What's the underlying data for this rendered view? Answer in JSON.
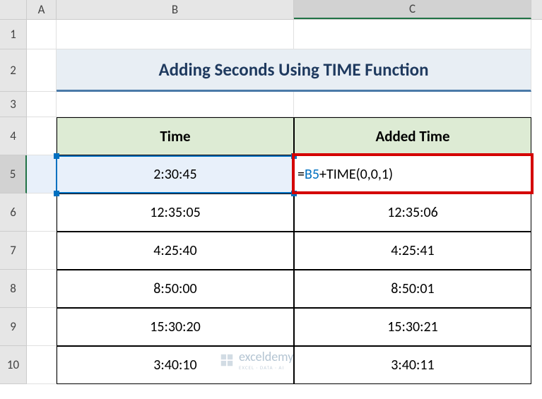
{
  "columns": {
    "A": "A",
    "B": "B",
    "C": "C"
  },
  "rows": {
    "1": "1",
    "2": "2",
    "3": "3",
    "4": "4",
    "5": "5",
    "6": "6",
    "7": "7",
    "8": "8",
    "9": "9",
    "10": "10"
  },
  "title": "Adding Seconds Using TIME Function",
  "headers": {
    "time": "Time",
    "added": "Added Time"
  },
  "data": [
    {
      "time": "2:30:45",
      "added_display": "formula"
    },
    {
      "time": "12:35:05",
      "added": "12:35:06"
    },
    {
      "time": "4:25:40",
      "added": "4:25:41"
    },
    {
      "time": "8:50:00",
      "added": "8:50:01"
    },
    {
      "time": "15:30:20",
      "added": "15:30:21"
    },
    {
      "time": "3:40:10",
      "added": "3:40:11"
    }
  ],
  "formula": {
    "prefix": "=",
    "ref": "B5",
    "rest": "+TIME(0,0,1)"
  },
  "watermark": {
    "brand": "exceldemy",
    "tagline": "EXCEL · DATA · AI"
  },
  "chart_data": {
    "type": "table",
    "title": "Adding Seconds Using TIME Function",
    "columns": [
      "Time",
      "Added Time"
    ],
    "rows": [
      [
        "2:30:45",
        "=B5+TIME(0,0,1)"
      ],
      [
        "12:35:05",
        "12:35:06"
      ],
      [
        "4:25:40",
        "4:25:41"
      ],
      [
        "8:50:00",
        "8:50:01"
      ],
      [
        "15:30:20",
        "15:30:21"
      ],
      [
        "3:40:10",
        "3:40:11"
      ]
    ]
  }
}
